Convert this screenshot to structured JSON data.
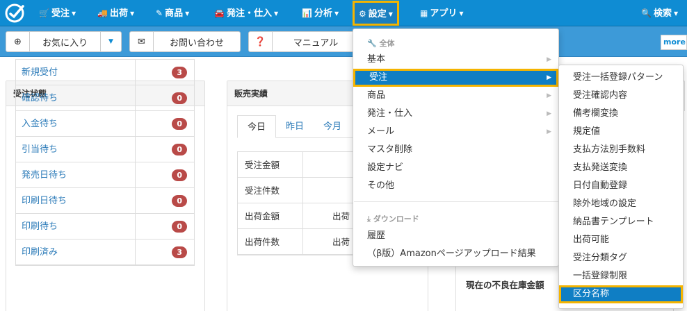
{
  "navbar": {
    "items": [
      {
        "label": "受注",
        "icon": "cart-icon",
        "glyph": "🛒"
      },
      {
        "label": "出荷",
        "icon": "truck-icon",
        "glyph": "🚚"
      },
      {
        "label": "商品",
        "icon": "pencil-icon",
        "glyph": "✎"
      },
      {
        "label": "発注・仕入",
        "icon": "car-icon",
        "glyph": "🚘"
      },
      {
        "label": "分析",
        "icon": "bar-chart-icon",
        "glyph": "📊"
      },
      {
        "label": "設定",
        "icon": "gear-icon",
        "glyph": "⚙"
      },
      {
        "label": "アプリ",
        "icon": "grid-icon",
        "glyph": "▦"
      }
    ],
    "search": {
      "label": "検索",
      "icon": "search-icon",
      "glyph": "🔍"
    }
  },
  "subbar": {
    "favorites": {
      "label": "お気に入り",
      "glyph": "⊕"
    },
    "contact": {
      "label": "お問い合わせ",
      "glyph": "✉"
    },
    "manual": {
      "label": "マニュアル",
      "glyph": "❓"
    },
    "brand": "more"
  },
  "order_status": {
    "title": "受注状態",
    "rows": [
      {
        "name": "新規受付",
        "count": "3"
      },
      {
        "name": "確認待ち",
        "count": "0"
      },
      {
        "name": "入金待ち",
        "count": "0"
      },
      {
        "name": "引当待ち",
        "count": "0"
      },
      {
        "name": "発売日待ち",
        "count": "0"
      },
      {
        "name": "印刷日待ち",
        "count": "0"
      },
      {
        "name": "印刷待ち",
        "count": "0"
      },
      {
        "name": "印刷済み",
        "count": "3"
      }
    ]
  },
  "sales": {
    "title": "販売実績",
    "tabs": [
      "今日",
      "昨日",
      "今月"
    ],
    "rows": [
      {
        "label": "受注金額",
        "value": ""
      },
      {
        "label": "受注件数",
        "value": ""
      },
      {
        "label": "出荷金額",
        "value": "出荷"
      },
      {
        "label": "出荷件数",
        "value": "出荷"
      }
    ]
  },
  "right_panel": {
    "label": "現在の不良在庫金額"
  },
  "settings_menu": {
    "header_all": "全体",
    "items_top": [
      {
        "label": "基本",
        "arrow": "▶"
      },
      {
        "label": "受注",
        "arrow": "▶"
      },
      {
        "label": "商品",
        "arrow": "▶"
      },
      {
        "label": "発注・仕入",
        "arrow": "▶"
      },
      {
        "label": "メール",
        "arrow": "▶"
      },
      {
        "label": "マスタ削除"
      },
      {
        "label": "設定ナビ"
      },
      {
        "label": "その他"
      }
    ],
    "header_download": "ダウンロード",
    "items_bottom": [
      {
        "label": "履歴"
      },
      {
        "label": "（β版）Amazonページアップロード結果"
      }
    ]
  },
  "order_submenu": {
    "items": [
      "受注一括登録パターン",
      "受注確認内容",
      "備考欄変換",
      "規定値",
      "支払方法別手数料",
      "支払発送変換",
      "日付自動登録",
      "除外地域の設定",
      "納品書テンプレート",
      "出荷可能",
      "受注分類タグ",
      "一括登録制限",
      "区分名称"
    ]
  }
}
